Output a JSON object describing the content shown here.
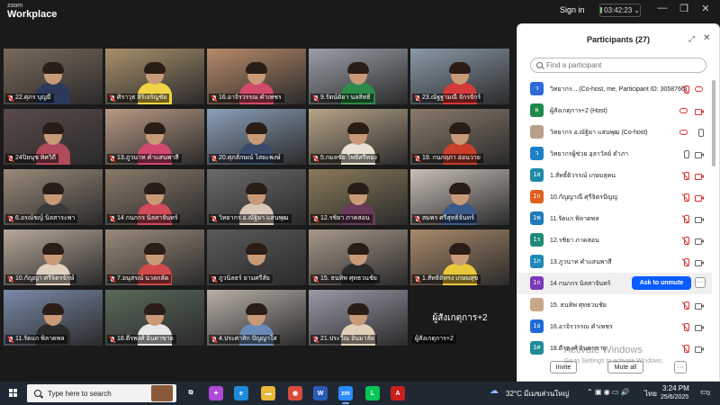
{
  "titlebar": {
    "brand_small": "zoom",
    "brand_big": "Workplace",
    "signin": "Sign in",
    "timer": "03:42:23",
    "minimize": "—",
    "restore": "❐",
    "close": "✕"
  },
  "gallery": {
    "tiles": [
      {
        "name": "22.ศุภร บุญมี",
        "bg": "#7a6a5c",
        "shirt": "#2b3a5a",
        "active": false
      },
      {
        "name": "ศิราวุธ สิริเจริญชัย",
        "bg": "#a8906c",
        "shirt": "#f1d346",
        "active": false
      },
      {
        "name": "16.อาจิรวรรณ คำเพชร",
        "bg": "#b88a6a",
        "shirt": "#d24a6a",
        "active": false
      },
      {
        "name": "9.รัตน์ติยา นลสิทธิ์",
        "bg": "#9aa0a8",
        "shirt": "#2e8a4a",
        "active": false
      },
      {
        "name": "23.ณัฐฐามณี จักรจักร์",
        "bg": "#8a9aa8",
        "shirt": "#d43a3a",
        "active": false
      },
      {
        "name": "24ปิยนุช ทิศวิถี",
        "bg": "#5a4a4a",
        "shirt": "#b14a5a",
        "active": false
      },
      {
        "name": "13.ภูวนาท คำแสนพาสี",
        "bg": "#b89a84",
        "shirt": "#d2486e",
        "active": false
      },
      {
        "name": "20.ศุภลักษณ์ ไสยะพงษ์",
        "bg": "#8aa0b8",
        "shirt": "#3a4a6a",
        "active": false
      },
      {
        "name": "5.กมลชัย โพธิ์ศรีทอง",
        "bg": "#b8a488",
        "shirt": "#e8e0d0",
        "active": false
      },
      {
        "name": "19. กนกฤภา อ่อนวาย",
        "bg": "#8a7a6a",
        "shirt": "#c8402a",
        "active": false
      },
      {
        "name": "6.อรณ์ชญ์ นิลสาระพา",
        "bg": "#9a8a7a",
        "shirt": "#3a3a3a",
        "active": false
      },
      {
        "name": "14 กนกกร นิลสาจันทร์",
        "bg": "#8a7a6a",
        "shirt": "#d24a5a",
        "active": false
      },
      {
        "name": "วิทยากร อ.ณัฐิยา แสนพุฒ",
        "bg": "#6a6a6a",
        "shirt": "#d8c8b8",
        "active": true
      },
      {
        "name": "12.รชิยา ภาคสอน",
        "bg": "#8a7a5a",
        "shirt": "#6a3a5a",
        "active": false
      },
      {
        "name": "สมพร ศรีสุทธิ์จันทร์",
        "bg": "#c8c0b8",
        "shirt": "#3a5a8a",
        "active": false
      },
      {
        "name": "10.กัญญา ศรีจิตรจักษ์",
        "bg": "#b8a89a",
        "shirt": "#e0d0c0",
        "active": false
      },
      {
        "name": "7.อนุสรณ์ นวลกลัด",
        "bg": "#9a8a7a",
        "shirt": "#d04a4a",
        "active": false
      },
      {
        "name": "ภูวนิลธร์ ยามศรีสัย",
        "bg": "#5a5a5a",
        "shirt": "#3a3a3a",
        "active": false
      },
      {
        "name": "15. ธนทิพ ศุทธวนชัย",
        "bg": "#a8988a",
        "shirt": "#2a2a2a",
        "active": false
      },
      {
        "name": "1.สัทธิ์ติทรง เกษมสุข",
        "bg": "#a88a6a",
        "shirt": "#e8c83a",
        "active": false
      },
      {
        "name": "11.รัดแก พิลาดพล",
        "bg": "#7a8aa8",
        "shirt": "#2a2a2a",
        "active": false
      },
      {
        "name": "18.ดีรพงศ์ อินตาขาย",
        "bg": "#5a6a5a",
        "shirt": "#e8e8e8",
        "active": false
      },
      {
        "name": "4.ประศาสิก ปัญญาใส",
        "bg": "#b8b0a8",
        "shirt": "#6a8ab8",
        "active": false
      },
      {
        "name": "21.ประวีณ อินมาลัย",
        "bg": "#9a9aa8",
        "shirt": "#e0d0b8",
        "active": false
      },
      {
        "name": "ผู้สังเกตุการ+2",
        "bg": "",
        "shirt": "",
        "active": false,
        "text_only": true,
        "big_label": "ผู้สังเกตุการ+2"
      }
    ]
  },
  "participants": {
    "title": "Participants (27)",
    "popout": "⤢",
    "close": "✕",
    "search_placeholder": "Find a participant",
    "rows": [
      {
        "initial": "ว",
        "color": "#2e6bd8",
        "name": "วิทยากร... (Co-host, me, Participant ID: 3058766)",
        "mic": "red",
        "cam": "cloud",
        "hl": false
      },
      {
        "initial": "ผ",
        "color": "#1f8a4c",
        "name": "ผู้สังเกตุการ+2 (Host)",
        "mic": "cloud",
        "cam": "red",
        "hl": false
      },
      {
        "initial": "",
        "color": "#b8a088",
        "name": "วิทยากร อ.ณัฐิยา แสนพุฒ (Co-host)",
        "mic": "cloud",
        "cam": "gray-mic",
        "hl": false
      },
      {
        "initial": "ว",
        "color": "#1c7fc8",
        "name": "วิทยากรผู้ช่วย อุลาวัลย์ ดำภา",
        "mic": "gray",
        "cam": "gray",
        "hl": false
      },
      {
        "initial": "1ส",
        "color": "#1f8aa8",
        "name": "1.สัทธิ์ติวรรณ์ เกษมสุคน",
        "mic": "red",
        "cam": "red",
        "hl": false
      },
      {
        "initial": "1ก",
        "color": "#e0601c",
        "name": "10.กัญญาณี ศุรีจิตรปัญญ",
        "mic": "red",
        "cam": "red",
        "hl": false
      },
      {
        "initial": "1พ",
        "color": "#1f7ab8",
        "name": "11.รัดแก พิลาดพล",
        "mic": "red",
        "cam": "gray",
        "hl": false
      },
      {
        "initial": "1ร",
        "color": "#1f8a7a",
        "name": "12.รชิยา ภาคสอน",
        "mic": "red",
        "cam": "gray",
        "hl": false
      },
      {
        "initial": "1ภ",
        "color": "#1f8ab8",
        "name": "13.ภูวนาท คำแสนพาสี",
        "mic": "red",
        "cam": "gray",
        "hl": false
      },
      {
        "initial": "1ก",
        "color": "#7a3ab8",
        "name": "14 กนกกร นิลสาจันทร์",
        "mic": "",
        "cam": "",
        "hl": true,
        "unmute": "Ask to unmute"
      },
      {
        "initial": "",
        "color": "#c8a888",
        "name": "15. ธนทิพ ศุทธวนชัย",
        "mic": "red",
        "cam": "gray",
        "hl": false
      },
      {
        "initial": "1อ",
        "color": "#1f6ad8",
        "name": "16.อาจิรวรรณ คำเพชร",
        "mic": "red",
        "cam": "gray",
        "hl": false
      },
      {
        "initial": "1ศ",
        "color": "#1f8a9a",
        "name": "18.ดีรพงศ์ อินตาขาย",
        "mic": "red",
        "cam": "gray",
        "hl": false
      }
    ],
    "more": "···",
    "invite": "Invite",
    "mute_all": "Mute all",
    "footer_more": "···"
  },
  "watermark": {
    "line1": "Activate Windows",
    "line2": "Go to Settings to activate Windows."
  },
  "taskbar": {
    "search_text": "Type here to search",
    "weather": "32°C มีเมฆส่วนใหญ่",
    "lang": "ไทย",
    "time": "3:24 PM",
    "date": "25/6/2025",
    "notif": "2",
    "apps": [
      {
        "name": "taskview-icon",
        "label": "⧉",
        "color": "transparent"
      },
      {
        "name": "copilot-icon",
        "label": "✦",
        "color": "#b04ad8"
      },
      {
        "name": "edge-icon",
        "label": "e",
        "color": "#1f8ad8"
      },
      {
        "name": "file-explorer-icon",
        "label": "▬",
        "color": "#e8b83a"
      },
      {
        "name": "chrome-icon",
        "label": "◉",
        "color": "#d84a3a"
      },
      {
        "name": "word-icon",
        "label": "W",
        "color": "#2a5ab8"
      },
      {
        "name": "zoom-icon",
        "label": "zm",
        "color": "#2d8cff"
      },
      {
        "name": "line-icon",
        "label": "L",
        "color": "#06c755"
      },
      {
        "name": "pdf-icon",
        "label": "A",
        "color": "#c8201c"
      }
    ]
  }
}
